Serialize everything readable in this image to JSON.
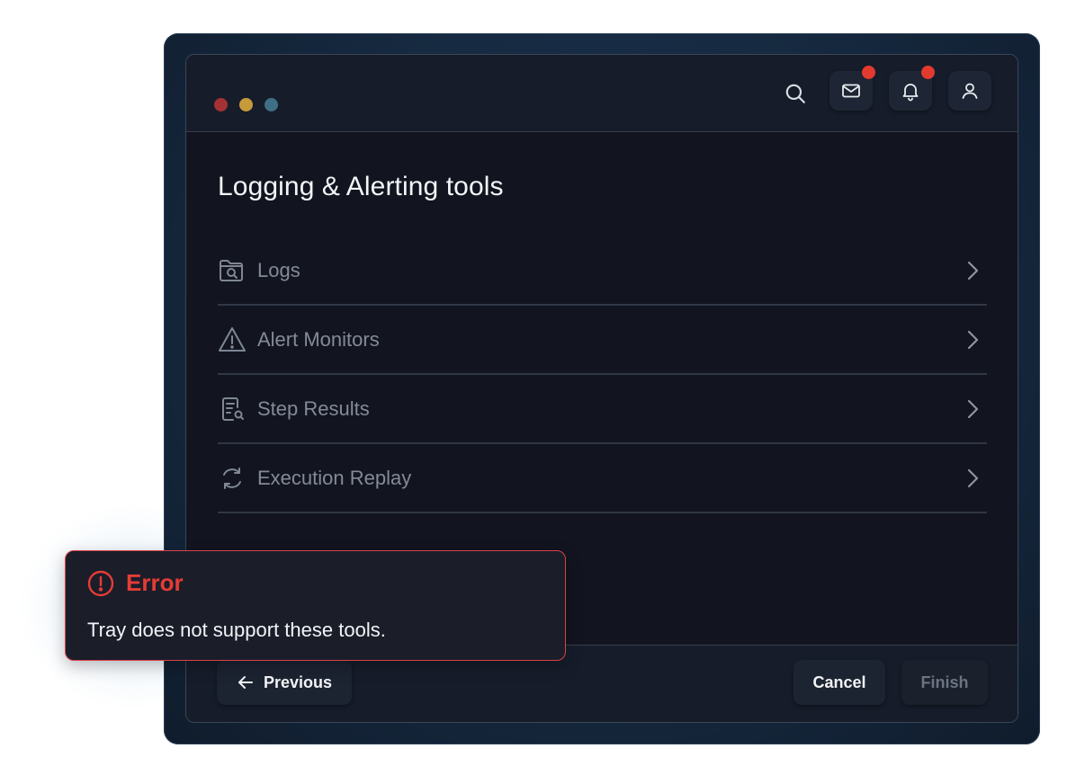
{
  "header": {
    "search_icon": "search-icon",
    "actions": [
      {
        "name": "mail",
        "icon": "mail-icon",
        "has_badge": true
      },
      {
        "name": "notifications",
        "icon": "bell-icon",
        "has_badge": true
      },
      {
        "name": "profile",
        "icon": "user-icon",
        "has_badge": false
      }
    ],
    "window_controls": [
      "#a33232",
      "#c79a3a",
      "#3f6f86"
    ]
  },
  "main": {
    "title": "Logging & Alerting tools",
    "tools": [
      {
        "label": "Logs",
        "icon": "folder-search-icon"
      },
      {
        "label": "Alert Monitors",
        "icon": "warning-triangle-icon"
      },
      {
        "label": "Step Results",
        "icon": "document-search-icon"
      },
      {
        "label": "Execution Replay",
        "icon": "replay-icon"
      }
    ]
  },
  "footer": {
    "previous_label": "Previous",
    "cancel_label": "Cancel",
    "finish_label": "Finish"
  },
  "error": {
    "title": "Error",
    "message": "Tray does not support these tools."
  },
  "colors": {
    "accent_error": "#e63c36",
    "badge": "#e23a2f",
    "background": "#121420"
  }
}
